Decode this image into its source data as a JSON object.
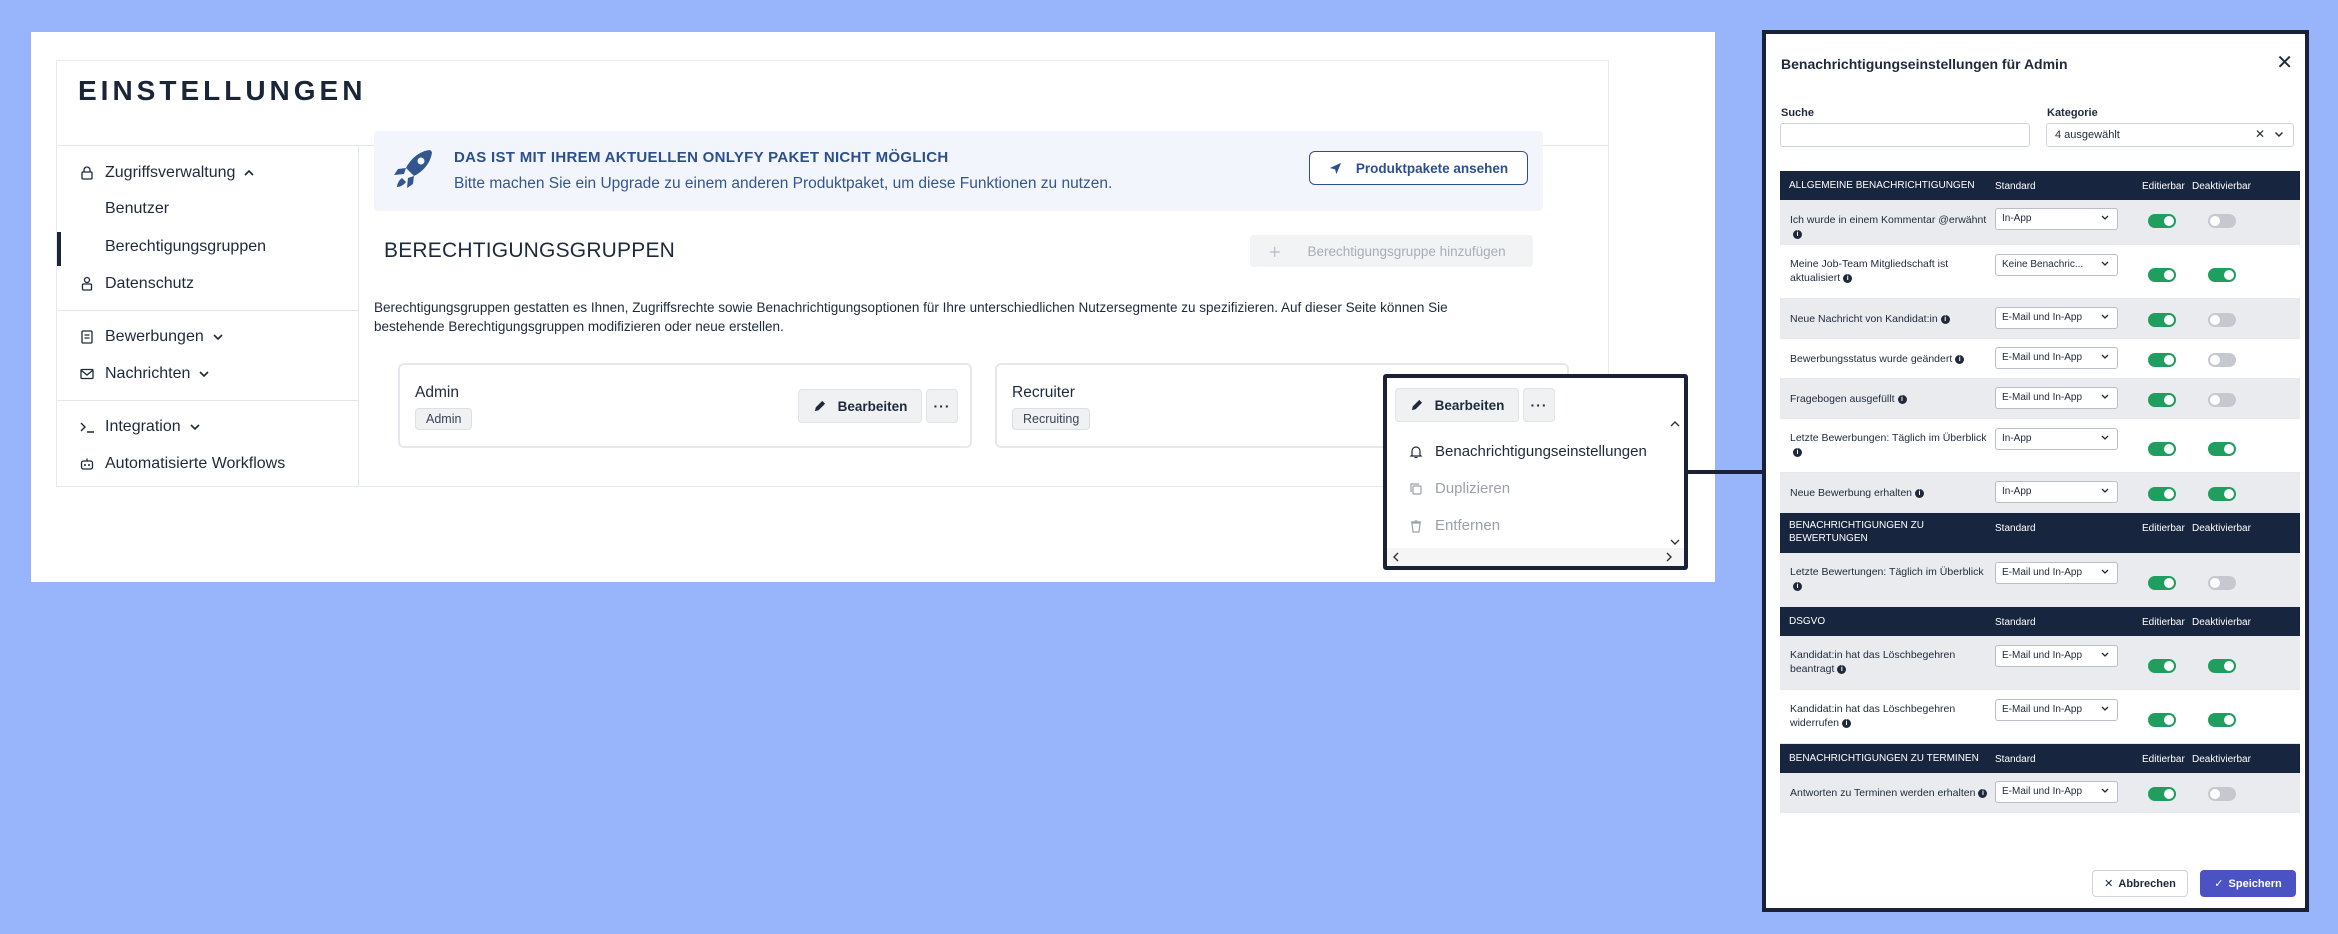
{
  "settings": {
    "title": "EINSTELLUNGEN",
    "sidebar": {
      "access": "Zugriffsverwaltung",
      "users": "Benutzer",
      "groups": "Berechtigungsgruppen",
      "privacy": "Datenschutz",
      "applications": "Bewerbungen",
      "messages": "Nachrichten",
      "integration": "Integration",
      "workflows": "Automatisierte Workflows"
    },
    "banner": {
      "title": "DAS IST MIT IHREM AKTUELLEN ONLYFY PAKET NICHT MÖGLICH",
      "text": "Bitte machen Sie ein Upgrade zu einem anderen Produktpaket, um diese Funktionen zu nutzen.",
      "button": "Produktpakete ansehen"
    },
    "section_title": "BERECHTIGUNGSGRUPPEN",
    "add_button": "Berechtigungsgruppe hinzufügen",
    "description": "Berechtigungsgruppen gestatten es Ihnen, Zugriffsrechte sowie Benachrichtigungsoptionen für Ihre unterschiedlichen Nutzersegmente zu spezifizieren. Auf dieser Seite können Sie bestehende Berechtigungsgruppen modifizieren oder neue erstellen.",
    "groups": [
      {
        "name": "Admin",
        "tag": "Admin",
        "edit": "Bearbeiten"
      },
      {
        "name": "Recruiter",
        "tag": "Recruiting",
        "edit": "Bearbeiten"
      }
    ],
    "more_label": "···"
  },
  "zoom": {
    "edit": "Bearbeiten",
    "more": "···",
    "menu": [
      "Benachrichtigungseinstellungen",
      "Duplizieren",
      "Entfernen"
    ]
  },
  "modal": {
    "title": "Benachrichtigungseinstellungen für Admin",
    "close": "✕",
    "search_label": "Suche",
    "category_label": "Kategorie",
    "category_value": "4 ausgewählt",
    "clear": "✕",
    "col_standard": "Standard",
    "col_editable": "Editierbar",
    "col_disable": "Deaktivierbar",
    "sections": [
      {
        "title": "ALLGEMEINE BENACHRICHTIGUNGEN",
        "rows": [
          {
            "label": "Ich wurde in einem Kommentar @erwähnt",
            "value": "In-App",
            "editable": true,
            "disable": false
          },
          {
            "label": "Meine Job-Team Mitgliedschaft ist aktualisiert",
            "value": "Keine Benachric...",
            "editable": true,
            "disable": true
          },
          {
            "label": "Neue Nachricht von Kandidat:in",
            "value": "E-Mail und In-App",
            "editable": true,
            "disable": false
          },
          {
            "label": "Bewerbungsstatus wurde geändert",
            "value": "E-Mail und In-App",
            "editable": true,
            "disable": false
          },
          {
            "label": "Fragebogen ausgefüllt",
            "value": "E-Mail und In-App",
            "editable": true,
            "disable": false
          },
          {
            "label": "Letzte Bewerbungen: Täglich im Überblick",
            "value": "In-App",
            "editable": true,
            "disable": true
          },
          {
            "label": "Neue Bewerbung erhalten",
            "value": "In-App",
            "editable": true,
            "disable": true
          }
        ]
      },
      {
        "title": "BENACHRICHTIGUNGEN ZU BEWERTUNGEN",
        "rows": [
          {
            "label": "Letzte Bewertungen: Täglich im Überblick",
            "value": "E-Mail und In-App",
            "editable": true,
            "disable": false
          }
        ]
      },
      {
        "title": "DSGVO",
        "rows": [
          {
            "label": "Kandidat:in hat das Löschbegehren beantragt",
            "value": "E-Mail und In-App",
            "editable": true,
            "disable": true
          },
          {
            "label": "Kandidat:in hat das Löschbegehren widerrufen",
            "value": "E-Mail und In-App",
            "editable": true,
            "disable": true
          }
        ]
      },
      {
        "title": "BENACHRICHTIGUNGEN ZU TERMINEN",
        "rows": [
          {
            "label": "Antworten zu Terminen werden erhalten",
            "value": "E-Mail und In-App",
            "editable": true,
            "disable": false
          }
        ]
      }
    ],
    "cancel": "Abbrechen",
    "save": "Speichern",
    "colors": {
      "header": "#18253f",
      "toggle_on": "#1f9e5f",
      "toggle_off": "#c5c9cf",
      "save": "#4b52c4"
    }
  }
}
